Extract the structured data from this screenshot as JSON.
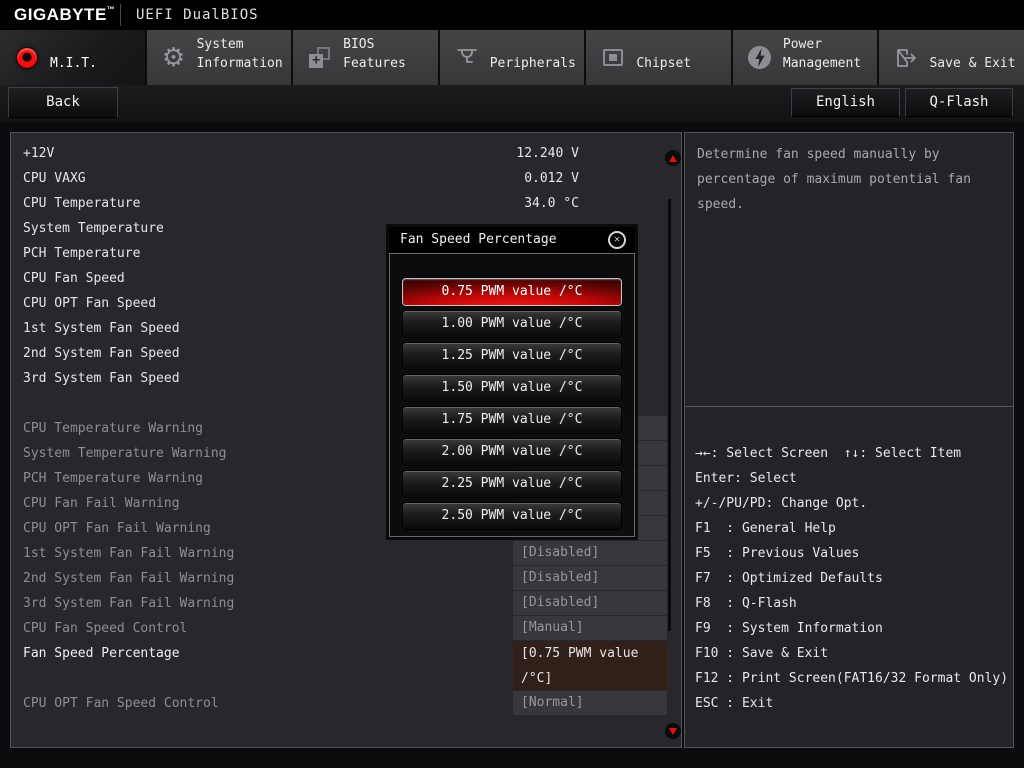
{
  "titlebar": {
    "brand": "GIGABYTE",
    "trademark": "™",
    "product": "UEFI DualBIOS"
  },
  "tabs": [
    {
      "id": "mit",
      "lines": [
        "M.I.T."
      ],
      "active": true
    },
    {
      "id": "system-information",
      "lines": [
        "System",
        "Information"
      ]
    },
    {
      "id": "bios-features",
      "lines": [
        "BIOS",
        "Features"
      ]
    },
    {
      "id": "peripherals",
      "lines": [
        "Peripherals"
      ]
    },
    {
      "id": "chipset",
      "lines": [
        "Chipset"
      ]
    },
    {
      "id": "power-management",
      "lines": [
        "Power",
        "Management"
      ]
    },
    {
      "id": "save-exit",
      "lines": [
        "Save & Exit"
      ]
    }
  ],
  "toolbar": {
    "back": "Back",
    "language": "English",
    "qflash": "Q-Flash"
  },
  "icons": {
    "gear": "⚙",
    "close": "✕"
  },
  "left_panel": {
    "sensors": [
      {
        "label": "+12V",
        "value": "12.240 V"
      },
      {
        "label": "CPU VAXG",
        "value": "0.012 V"
      },
      {
        "label": "CPU Temperature",
        "value": "34.0 °C"
      },
      {
        "label": "System Temperature",
        "value": ""
      },
      {
        "label": "PCH Temperature",
        "value": ""
      },
      {
        "label": "CPU Fan Speed",
        "value": ""
      },
      {
        "label": "CPU OPT Fan Speed",
        "value": ""
      },
      {
        "label": "1st System Fan Speed",
        "value": ""
      },
      {
        "label": "2nd System Fan Speed",
        "value": ""
      },
      {
        "label": "3rd System Fan Speed",
        "value": ""
      }
    ],
    "settings": [
      {
        "label": "CPU Temperature Warning",
        "value": ""
      },
      {
        "label": "System Temperature Warning",
        "value": ""
      },
      {
        "label": "PCH Temperature Warning",
        "value": ""
      },
      {
        "label": "CPU Fan Fail Warning",
        "value": ""
      },
      {
        "label": "CPU OPT Fan Fail Warning",
        "value": ""
      },
      {
        "label": "1st System Fan Fail Warning",
        "value": "[Disabled]"
      },
      {
        "label": "2nd System Fan Fail Warning",
        "value": "[Disabled]"
      },
      {
        "label": "3rd System Fan Fail Warning",
        "value": "[Disabled]"
      },
      {
        "label": "CPU Fan Speed Control",
        "value": "[Manual]"
      },
      {
        "label": "Fan Speed Percentage",
        "value_line1": "[0.75 PWM value",
        "value_line2": "/°C]",
        "selected": true
      },
      {
        "label": "CPU OPT Fan Speed Control",
        "value": "[Normal]"
      }
    ]
  },
  "popup": {
    "title": "Fan Speed Percentage",
    "options": [
      "0.75 PWM value /°C",
      "1.00 PWM value /°C",
      "1.25 PWM value /°C",
      "1.50 PWM value /°C",
      "1.75 PWM value /°C",
      "2.00 PWM value /°C",
      "2.25 PWM value /°C",
      "2.50 PWM value /°C"
    ],
    "selected_index": 0
  },
  "right_panel": {
    "help": "Determine fan speed manually by percentage of maximum potential fan speed.",
    "shortcuts": [
      "→←: Select Screen  ↑↓: Select Item",
      "Enter: Select",
      "+/-/PU/PD: Change Opt.",
      "F1  : General Help",
      "F5  : Previous Values",
      "F7  : Optimized Defaults",
      "F8  : Q-Flash",
      "F9  : System Information",
      "F10 : Save & Exit",
      "F12 : Print Screen(FAT16/32 Format Only)",
      "ESC : Exit"
    ]
  },
  "colors": {
    "accent_red": "#e01010",
    "selected_value_bg": "#311f19",
    "panel_bg": "#28282c"
  }
}
